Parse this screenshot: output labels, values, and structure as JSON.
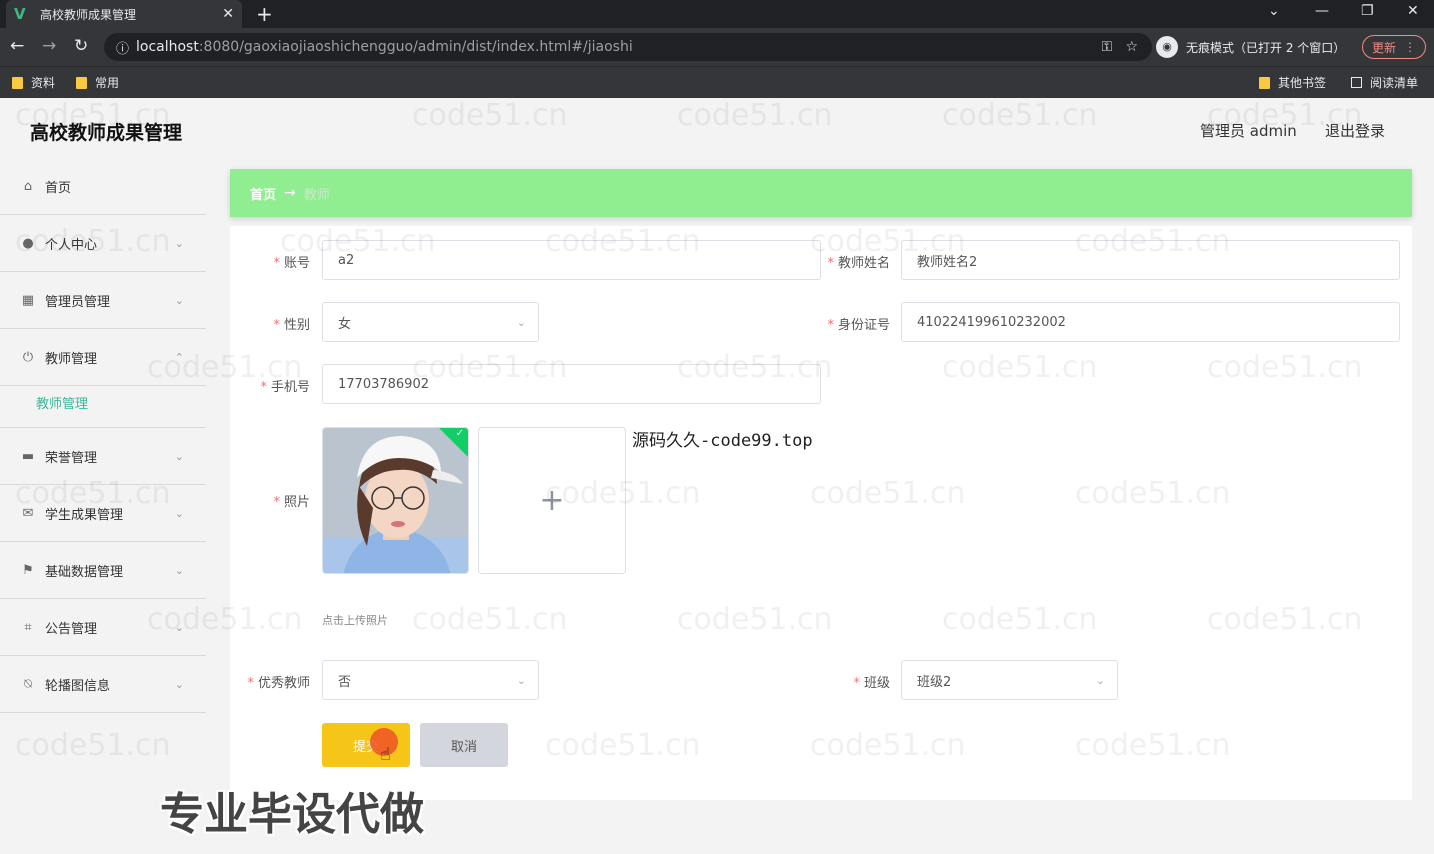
{
  "browser": {
    "tab_title": "高校教师成果管理",
    "tab_close": "✕",
    "new_tab": "+",
    "url_host": "localhost",
    "url_rest": ":8080/gaoxiaojiaoshichengguo/admin/dist/index.html#/jiaoshi",
    "incognito_label": "无痕模式（已打开 2 个窗口）",
    "update_label": "更新",
    "bookmarks": [
      "资料",
      "常用"
    ],
    "other_bookmarks": "其他书签",
    "reading_list": "阅读清单"
  },
  "app": {
    "title": "高校教师成果管理",
    "admin_label": "管理员 admin",
    "logout_label": "退出登录"
  },
  "sidebar": {
    "items": [
      {
        "label": "首页",
        "icon": "home-icon"
      },
      {
        "label": "个人中心",
        "icon": "user-icon"
      },
      {
        "label": "管理员管理",
        "icon": "grid-icon"
      },
      {
        "label": "教师管理",
        "icon": "power-icon"
      },
      {
        "label": "荣誉管理",
        "icon": "podium-icon"
      },
      {
        "label": "学生成果管理",
        "icon": "mail-icon"
      },
      {
        "label": "基础数据管理",
        "icon": "flag-icon"
      },
      {
        "label": "公告管理",
        "icon": "crop-icon"
      },
      {
        "label": "轮播图信息",
        "icon": "bell-off-icon"
      }
    ],
    "active_sub": "教师管理"
  },
  "breadcrumb": {
    "home": "首页",
    "arrow": "→",
    "current": "教师"
  },
  "form": {
    "account": {
      "label": "账号",
      "value": "a2"
    },
    "teacher_name": {
      "label": "教师姓名",
      "value": "教师姓名2"
    },
    "gender": {
      "label": "性别",
      "value": "女"
    },
    "id_card": {
      "label": "身份证号",
      "value": "410224199610232002"
    },
    "phone": {
      "label": "手机号",
      "value": "17703786902"
    },
    "photo": {
      "label": "照片",
      "hint": "点击上传照片"
    },
    "code_note": "源码久久-code99.top",
    "excellent": {
      "label": "优秀教师",
      "value": "否"
    },
    "class": {
      "label": "班级",
      "value": "班级2"
    },
    "submit_label": "提交",
    "cancel_label": "取消"
  },
  "promo_text": "专业毕设代做",
  "watermark_text": "code51.cn"
}
